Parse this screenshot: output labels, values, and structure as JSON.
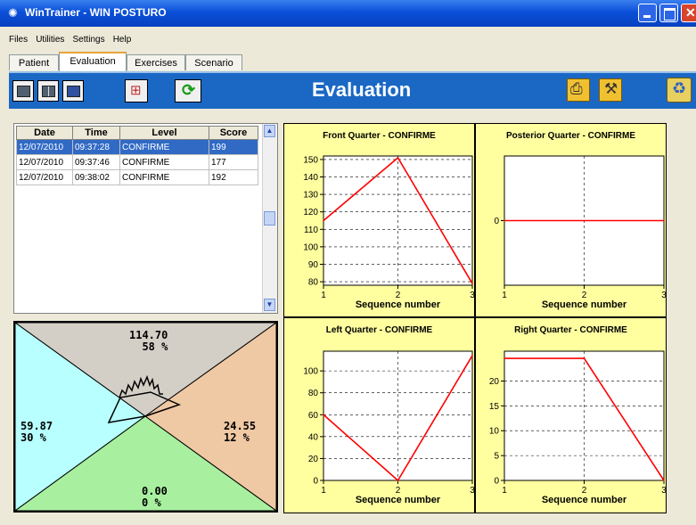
{
  "window": {
    "title": "WinTrainer - WIN POSTURO",
    "app_icon": "sun-icon"
  },
  "menu": [
    "Files",
    "Utilities",
    "Settings",
    "Help"
  ],
  "tabs": [
    "Patient",
    "Evaluation",
    "Exercises",
    "Scenario"
  ],
  "toolbar": {
    "title": "Evaluation",
    "accent": "#1a68c4"
  },
  "table": {
    "headers": [
      "Date",
      "Time",
      "Level",
      "Score"
    ],
    "rows": [
      [
        "12/07/2010",
        "09:37:28",
        "CONFIRME",
        "199"
      ],
      [
        "12/07/2010",
        "09:37:46",
        "CONFIRME",
        "177"
      ],
      [
        "12/07/2010",
        "09:38:02",
        "CONFIRME",
        "192"
      ]
    ]
  },
  "gauge": {
    "top": {
      "value": "114.70",
      "pct": "58 %"
    },
    "left": {
      "value": "59.87",
      "pct": "30 %"
    },
    "right": {
      "value": "24.55",
      "pct": "12 %"
    },
    "bottom": {
      "value": "0.00",
      "pct": "0 %"
    }
  },
  "chart_data": [
    {
      "type": "line",
      "title": "Front Quarter - CONFIRME",
      "xlabel": "Sequence number",
      "x": [
        1,
        2,
        3
      ],
      "y": [
        115,
        151,
        79
      ],
      "ylim": [
        78,
        152
      ],
      "yticks": [
        80,
        90,
        100,
        110,
        120,
        130,
        140,
        150
      ],
      "color": "#ff0000"
    },
    {
      "type": "line",
      "title": "Posterior Quarter - CONFIRME",
      "xlabel": "Sequence number",
      "x": [
        1,
        2,
        3
      ],
      "y": [
        0,
        0,
        0
      ],
      "ylim": [
        -1,
        1
      ],
      "yticks": [
        0
      ],
      "color": "#ff0000"
    },
    {
      "type": "line",
      "title": "Left Quarter - CONFIRME",
      "xlabel": "Sequence number",
      "x": [
        1,
        2,
        3
      ],
      "y": [
        60,
        0,
        114
      ],
      "ylim": [
        0,
        118
      ],
      "yticks": [
        0,
        20,
        40,
        60,
        80,
        100
      ],
      "color": "#ff0000"
    },
    {
      "type": "line",
      "title": "Right Quarter - CONFIRME",
      "xlabel": "Sequence number",
      "x": [
        1,
        2,
        3
      ],
      "y": [
        24.55,
        24.55,
        0
      ],
      "ylim": [
        0,
        26
      ],
      "yticks": [
        0,
        5,
        10,
        15,
        20
      ],
      "color": "#ff0000"
    }
  ]
}
